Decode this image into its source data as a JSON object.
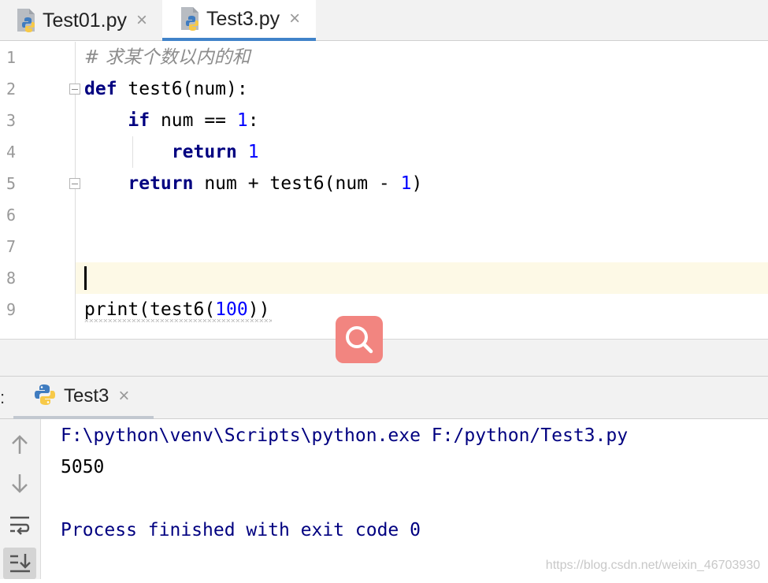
{
  "editor_tabs": [
    {
      "label": "Test01.py",
      "icon": "python-file-icon",
      "active": false
    },
    {
      "label": "Test3.py",
      "icon": "python-file-icon",
      "active": true
    }
  ],
  "tab_close_glyph": "×",
  "gutter": {
    "line_numbers": [
      "1",
      "2",
      "3",
      "4",
      "5",
      "6",
      "7",
      "8",
      "9"
    ]
  },
  "code": {
    "line1": {
      "comment": "# 求某个数以内的和"
    },
    "line2": {
      "kw": "def",
      "rest": " test6(num):"
    },
    "line3": {
      "indent": "    ",
      "kw": "if",
      "mid": " num == ",
      "num": "1",
      "end": ":"
    },
    "line4": {
      "indent": "        ",
      "kw": "return",
      "sp": " ",
      "num": "1"
    },
    "line5": {
      "indent": "    ",
      "kw": "return",
      "mid": " num + test6(num - ",
      "num": "1",
      "end": ")"
    },
    "line9": {
      "pre": "print(test6(",
      "num": "100",
      "end": "))"
    }
  },
  "run_panel": {
    "prefix": ":",
    "tab_label": "Test3",
    "tab_icon": "python-icon"
  },
  "console": {
    "command": "F:\\python\\venv\\Scripts\\python.exe F:/python/Test3.py",
    "output": "5050",
    "exit": "Process finished with exit code 0"
  },
  "colors": {
    "keyword": "#000080",
    "number": "#0000ff",
    "comment": "#8c8c8c",
    "active_tab_underline": "#4083c9",
    "current_line": "#fdf9e6",
    "search_button": "#f28580"
  },
  "watermark": "https://blog.csdn.net/weixin_46703930"
}
